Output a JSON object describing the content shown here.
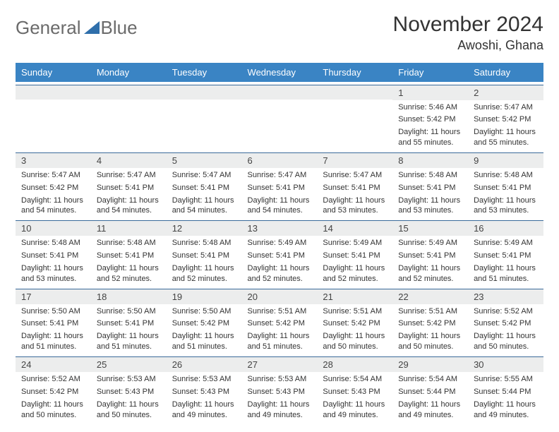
{
  "brand": {
    "part1": "General",
    "part2": "Blue"
  },
  "title": "November 2024",
  "location": "Awoshi, Ghana",
  "day_names": [
    "Sunday",
    "Monday",
    "Tuesday",
    "Wednesday",
    "Thursday",
    "Friday",
    "Saturday"
  ],
  "weeks": [
    [
      {
        "num": "",
        "sunrise": "",
        "sunset": "",
        "daylight": ""
      },
      {
        "num": "",
        "sunrise": "",
        "sunset": "",
        "daylight": ""
      },
      {
        "num": "",
        "sunrise": "",
        "sunset": "",
        "daylight": ""
      },
      {
        "num": "",
        "sunrise": "",
        "sunset": "",
        "daylight": ""
      },
      {
        "num": "",
        "sunrise": "",
        "sunset": "",
        "daylight": ""
      },
      {
        "num": "1",
        "sunrise": "Sunrise: 5:46 AM",
        "sunset": "Sunset: 5:42 PM",
        "daylight": "Daylight: 11 hours and 55 minutes."
      },
      {
        "num": "2",
        "sunrise": "Sunrise: 5:47 AM",
        "sunset": "Sunset: 5:42 PM",
        "daylight": "Daylight: 11 hours and 55 minutes."
      }
    ],
    [
      {
        "num": "3",
        "sunrise": "Sunrise: 5:47 AM",
        "sunset": "Sunset: 5:42 PM",
        "daylight": "Daylight: 11 hours and 54 minutes."
      },
      {
        "num": "4",
        "sunrise": "Sunrise: 5:47 AM",
        "sunset": "Sunset: 5:41 PM",
        "daylight": "Daylight: 11 hours and 54 minutes."
      },
      {
        "num": "5",
        "sunrise": "Sunrise: 5:47 AM",
        "sunset": "Sunset: 5:41 PM",
        "daylight": "Daylight: 11 hours and 54 minutes."
      },
      {
        "num": "6",
        "sunrise": "Sunrise: 5:47 AM",
        "sunset": "Sunset: 5:41 PM",
        "daylight": "Daylight: 11 hours and 54 minutes."
      },
      {
        "num": "7",
        "sunrise": "Sunrise: 5:47 AM",
        "sunset": "Sunset: 5:41 PM",
        "daylight": "Daylight: 11 hours and 53 minutes."
      },
      {
        "num": "8",
        "sunrise": "Sunrise: 5:48 AM",
        "sunset": "Sunset: 5:41 PM",
        "daylight": "Daylight: 11 hours and 53 minutes."
      },
      {
        "num": "9",
        "sunrise": "Sunrise: 5:48 AM",
        "sunset": "Sunset: 5:41 PM",
        "daylight": "Daylight: 11 hours and 53 minutes."
      }
    ],
    [
      {
        "num": "10",
        "sunrise": "Sunrise: 5:48 AM",
        "sunset": "Sunset: 5:41 PM",
        "daylight": "Daylight: 11 hours and 53 minutes."
      },
      {
        "num": "11",
        "sunrise": "Sunrise: 5:48 AM",
        "sunset": "Sunset: 5:41 PM",
        "daylight": "Daylight: 11 hours and 52 minutes."
      },
      {
        "num": "12",
        "sunrise": "Sunrise: 5:48 AM",
        "sunset": "Sunset: 5:41 PM",
        "daylight": "Daylight: 11 hours and 52 minutes."
      },
      {
        "num": "13",
        "sunrise": "Sunrise: 5:49 AM",
        "sunset": "Sunset: 5:41 PM",
        "daylight": "Daylight: 11 hours and 52 minutes."
      },
      {
        "num": "14",
        "sunrise": "Sunrise: 5:49 AM",
        "sunset": "Sunset: 5:41 PM",
        "daylight": "Daylight: 11 hours and 52 minutes."
      },
      {
        "num": "15",
        "sunrise": "Sunrise: 5:49 AM",
        "sunset": "Sunset: 5:41 PM",
        "daylight": "Daylight: 11 hours and 52 minutes."
      },
      {
        "num": "16",
        "sunrise": "Sunrise: 5:49 AM",
        "sunset": "Sunset: 5:41 PM",
        "daylight": "Daylight: 11 hours and 51 minutes."
      }
    ],
    [
      {
        "num": "17",
        "sunrise": "Sunrise: 5:50 AM",
        "sunset": "Sunset: 5:41 PM",
        "daylight": "Daylight: 11 hours and 51 minutes."
      },
      {
        "num": "18",
        "sunrise": "Sunrise: 5:50 AM",
        "sunset": "Sunset: 5:41 PM",
        "daylight": "Daylight: 11 hours and 51 minutes."
      },
      {
        "num": "19",
        "sunrise": "Sunrise: 5:50 AM",
        "sunset": "Sunset: 5:42 PM",
        "daylight": "Daylight: 11 hours and 51 minutes."
      },
      {
        "num": "20",
        "sunrise": "Sunrise: 5:51 AM",
        "sunset": "Sunset: 5:42 PM",
        "daylight": "Daylight: 11 hours and 51 minutes."
      },
      {
        "num": "21",
        "sunrise": "Sunrise: 5:51 AM",
        "sunset": "Sunset: 5:42 PM",
        "daylight": "Daylight: 11 hours and 50 minutes."
      },
      {
        "num": "22",
        "sunrise": "Sunrise: 5:51 AM",
        "sunset": "Sunset: 5:42 PM",
        "daylight": "Daylight: 11 hours and 50 minutes."
      },
      {
        "num": "23",
        "sunrise": "Sunrise: 5:52 AM",
        "sunset": "Sunset: 5:42 PM",
        "daylight": "Daylight: 11 hours and 50 minutes."
      }
    ],
    [
      {
        "num": "24",
        "sunrise": "Sunrise: 5:52 AM",
        "sunset": "Sunset: 5:42 PM",
        "daylight": "Daylight: 11 hours and 50 minutes."
      },
      {
        "num": "25",
        "sunrise": "Sunrise: 5:53 AM",
        "sunset": "Sunset: 5:43 PM",
        "daylight": "Daylight: 11 hours and 50 minutes."
      },
      {
        "num": "26",
        "sunrise": "Sunrise: 5:53 AM",
        "sunset": "Sunset: 5:43 PM",
        "daylight": "Daylight: 11 hours and 49 minutes."
      },
      {
        "num": "27",
        "sunrise": "Sunrise: 5:53 AM",
        "sunset": "Sunset: 5:43 PM",
        "daylight": "Daylight: 11 hours and 49 minutes."
      },
      {
        "num": "28",
        "sunrise": "Sunrise: 5:54 AM",
        "sunset": "Sunset: 5:43 PM",
        "daylight": "Daylight: 11 hours and 49 minutes."
      },
      {
        "num": "29",
        "sunrise": "Sunrise: 5:54 AM",
        "sunset": "Sunset: 5:44 PM",
        "daylight": "Daylight: 11 hours and 49 minutes."
      },
      {
        "num": "30",
        "sunrise": "Sunrise: 5:55 AM",
        "sunset": "Sunset: 5:44 PM",
        "daylight": "Daylight: 11 hours and 49 minutes."
      }
    ]
  ]
}
